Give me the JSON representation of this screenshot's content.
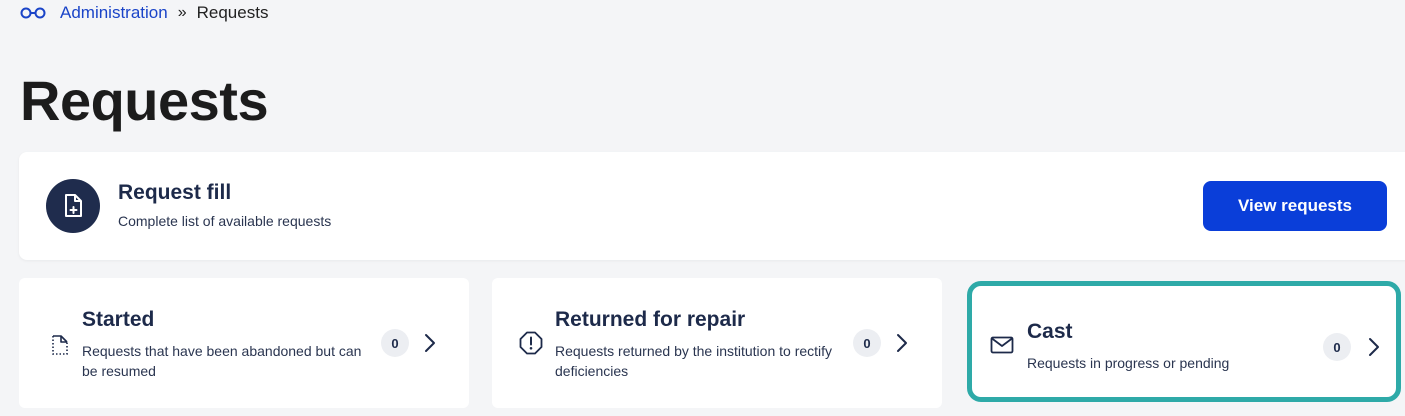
{
  "breadcrumb": {
    "icon": "glasses-icon",
    "root": "Administration",
    "separator": "»",
    "current": "Requests"
  },
  "page": {
    "title": "Requests"
  },
  "request_fill": {
    "icon": "file-plus-icon",
    "title": "Request fill",
    "subtitle": "Complete list of available requests",
    "button_label": "View requests"
  },
  "status_cards": [
    {
      "icon": "file-dashed-icon",
      "title": "Started",
      "description": "Requests that have been abandoned but can be resumed",
      "count": "0"
    },
    {
      "icon": "alert-octagon-icon",
      "title": "Returned for repair",
      "description": "Requests returned by the institution to rectify deficiencies",
      "count": "0"
    },
    {
      "icon": "envelope-icon",
      "title": "Cast",
      "description": "Requests in progress or pending",
      "count": "0",
      "highlighted": true
    }
  ],
  "colors": {
    "accent_button": "#0a3ed9",
    "link": "#1a44c8",
    "highlight_border": "#2eaaa8",
    "dark_navy": "#1f2c4d"
  }
}
